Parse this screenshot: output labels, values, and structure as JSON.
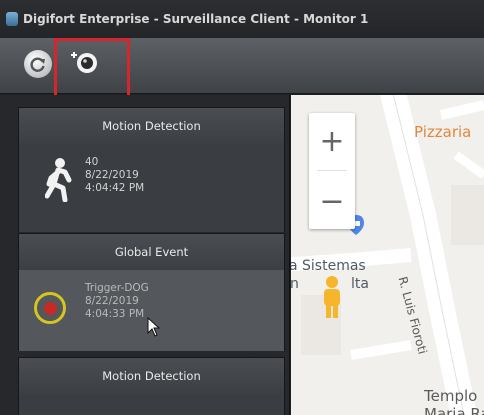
{
  "window": {
    "title": "Digifort Enterprise - Surveillance Client - Monitor 1",
    "icon": "app-icon"
  },
  "toolbar": {
    "buttons": [
      {
        "name": "refresh",
        "icon": "refresh-icon"
      },
      {
        "name": "add-camera",
        "icon": "camera-add-icon",
        "highlighted": true
      }
    ],
    "highlight_color": "#d6262b"
  },
  "events": [
    {
      "header": "Motion Detection",
      "icon": "running-person-icon",
      "lines": [
        "40",
        "8/22/2019",
        "4:04:42 PM"
      ],
      "selected": false
    },
    {
      "header": "Global Event",
      "icon": "trigger-icon",
      "lines": [
        "Trigger-DOG",
        "8/22/2019",
        "4:04:33 PM"
      ],
      "selected": true,
      "icon_ring_color": "#d7c51f",
      "icon_dot_color": "#c52a24"
    },
    {
      "header": "Motion Detection",
      "icon": "running-person-icon",
      "lines": [],
      "selected": false
    }
  ],
  "map": {
    "labels": {
      "pizzaria": "Pizzaria",
      "sistemas": "a Sistemas",
      "sistemas_line2": "n",
      "sistemas_line2b": "lta",
      "street": "R. Luis Fioroti",
      "templo": "Templo",
      "templo_line2": "Maria Ra"
    },
    "zoom_in": "+",
    "zoom_out": "−",
    "accent_orange": "#e0883f",
    "pegman_color": "#f7b52c",
    "pin_color": "#4f86e8"
  }
}
